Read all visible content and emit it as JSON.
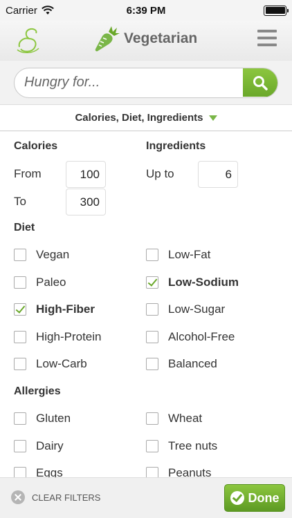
{
  "status_bar": {
    "carrier": "Carrier",
    "time": "6:39 PM",
    "icons": [
      "wifi-icon",
      "battery-icon"
    ]
  },
  "header": {
    "title": "Vegetarian",
    "icons": [
      "logo-icon",
      "carrot-icon",
      "menu-icon"
    ]
  },
  "search": {
    "placeholder": "Hungry for...",
    "value": "",
    "icon": "search-icon"
  },
  "filter_summary": {
    "label": "Calories, Diet, Ingredients",
    "icon": "triangle-down-icon"
  },
  "calories": {
    "heading": "Calories",
    "from_label": "From",
    "from_value": "100",
    "to_label": "To",
    "to_value": "300"
  },
  "ingredients": {
    "heading": "Ingredients",
    "up_to_label": "Up to",
    "up_to_value": "6"
  },
  "diet": {
    "heading": "Diet",
    "options": [
      {
        "label": "Vegan",
        "checked": false
      },
      {
        "label": "Low-Fat",
        "checked": false
      },
      {
        "label": "Paleo",
        "checked": false
      },
      {
        "label": "Low-Sodium",
        "checked": true
      },
      {
        "label": "High-Fiber",
        "checked": true
      },
      {
        "label": "Low-Sugar",
        "checked": false
      },
      {
        "label": "High-Protein",
        "checked": false
      },
      {
        "label": "Alcohol-Free",
        "checked": false
      },
      {
        "label": "Low-Carb",
        "checked": false
      },
      {
        "label": "Balanced",
        "checked": false
      }
    ]
  },
  "allergies": {
    "heading": "Allergies",
    "options": [
      {
        "label": "Gluten",
        "checked": false
      },
      {
        "label": "Wheat",
        "checked": false
      },
      {
        "label": "Dairy",
        "checked": false
      },
      {
        "label": "Tree nuts",
        "checked": false
      },
      {
        "label": "Eggs",
        "checked": false
      },
      {
        "label": "Peanuts",
        "checked": false
      }
    ]
  },
  "footer": {
    "clear_label": "CLEAR FILTERS",
    "done_label": "Done"
  },
  "colors": {
    "accent_green": "#7ab648",
    "dark_green": "#5d9a23",
    "header_text": "#666666"
  }
}
